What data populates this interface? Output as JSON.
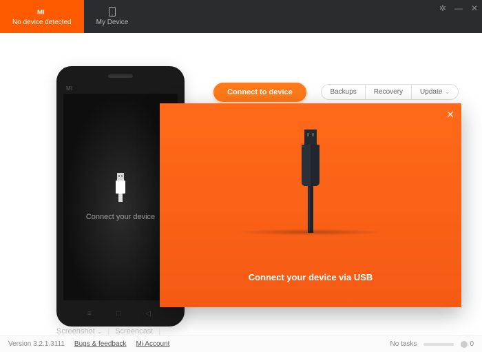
{
  "header": {
    "tab_active_label": "No device detected",
    "tab_mydevice_label": "My Device"
  },
  "main": {
    "phone_prompt": "Connect your device",
    "connect_button": "Connect to device",
    "backups": "Backups",
    "recovery": "Recovery",
    "update": "Update",
    "bottom_screenshot": "Screenshot",
    "bottom_screencast": "Screencast"
  },
  "modal": {
    "text": "Connect your device via USB"
  },
  "footer": {
    "version_label": "Version 3.2.1.3111",
    "bugs": "Bugs & feedback",
    "account": "Mi Account",
    "no_tasks": "No tasks",
    "task_count": "0"
  }
}
